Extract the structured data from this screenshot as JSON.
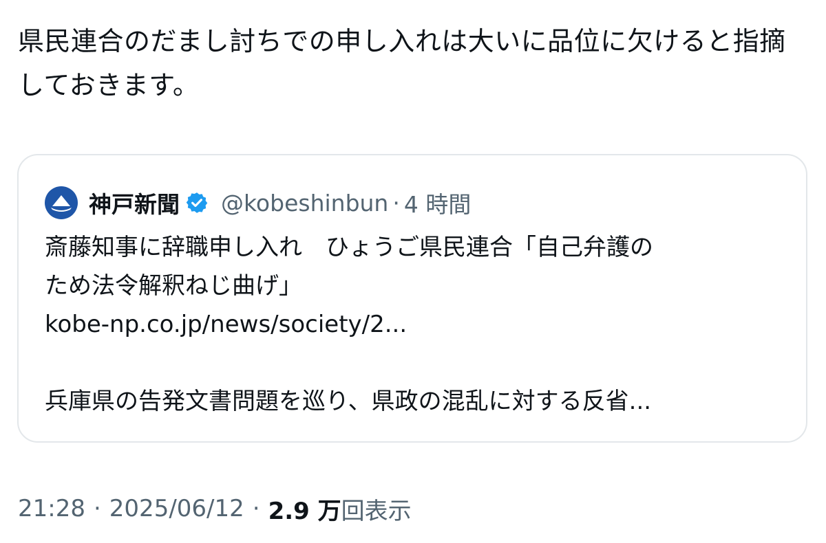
{
  "tweet": {
    "text": "県民連合のだまし討ちでの申し入れは大いに品位に欠けると指摘しておきます。"
  },
  "quote": {
    "author_name": "神戸新聞",
    "handle": "@kobeshinbun",
    "separator": "·",
    "time": "4 時間",
    "headline_line1": "斎藤知事に辞職申し入れ　ひょうご県民連合「自己弁護の",
    "headline_line2": "ため法令解釈ねじ曲げ」",
    "link": "kobe-np.co.jp/news/society/2...",
    "summary": "兵庫県の告発文書問題を巡り、県政の混乱に対する反省..."
  },
  "footer": {
    "time": "21:28",
    "separator": "·",
    "date": "2025/06/12",
    "views_count": "2.9 万",
    "views_label": "回表示"
  },
  "colors": {
    "text": "#0f1419",
    "secondary": "#536471",
    "border": "#e3e7ea",
    "verified_blue": "#1d9bf0",
    "avatar_bg": "#1f56a8"
  },
  "icons": {
    "avatar": "kobe-shinbun-logo",
    "verified": "verified-badge-icon"
  }
}
